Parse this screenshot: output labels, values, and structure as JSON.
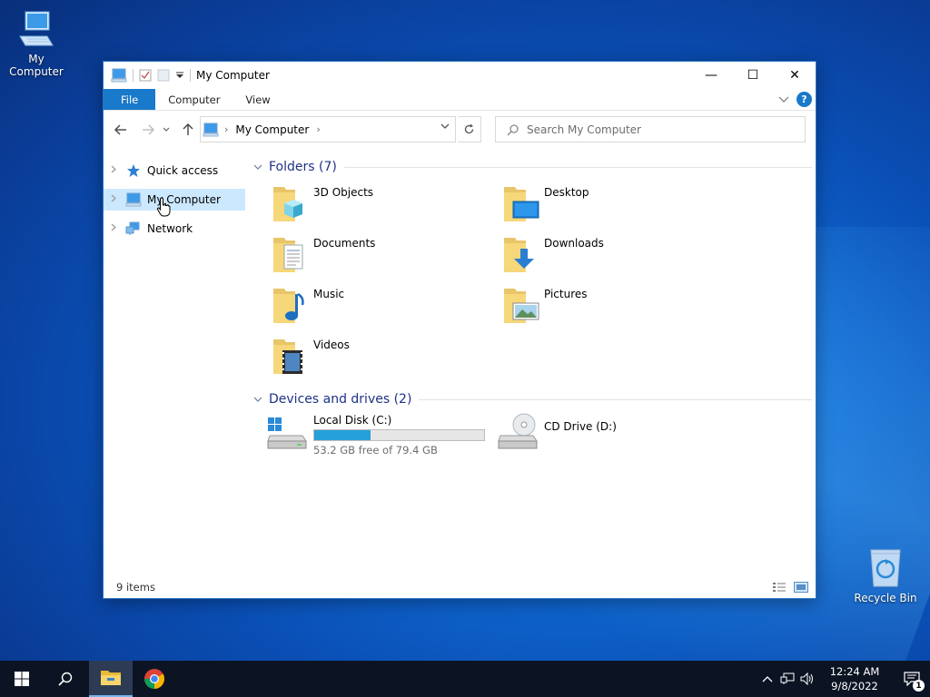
{
  "desktop": {
    "icons": [
      {
        "label": "My Computer",
        "icon": "computer-icon"
      },
      {
        "label": "Recycle Bin",
        "icon": "recycle-bin-icon"
      }
    ]
  },
  "window": {
    "title": "My Computer",
    "controls": {
      "minimize": "—",
      "maximize": "☐",
      "close": "✕"
    },
    "ribbon_tabs": [
      "File",
      "Computer",
      "View"
    ],
    "help": "?",
    "address": {
      "crumb": "My Computer",
      "chevron": "›"
    },
    "search": {
      "placeholder": "Search My Computer"
    },
    "nav": [
      {
        "label": "Quick access",
        "icon": "star-icon",
        "selected": false
      },
      {
        "label": "My Computer",
        "icon": "computer-icon",
        "selected": true
      },
      {
        "label": "Network",
        "icon": "network-icon",
        "selected": false
      }
    ],
    "folders_header": "Folders (7)",
    "folders": [
      {
        "label": "3D Objects",
        "icon": "3d-objects-icon"
      },
      {
        "label": "Desktop",
        "icon": "desktop-folder-icon"
      },
      {
        "label": "Documents",
        "icon": "documents-folder-icon"
      },
      {
        "label": "Downloads",
        "icon": "downloads-folder-icon"
      },
      {
        "label": "Music",
        "icon": "music-folder-icon"
      },
      {
        "label": "Pictures",
        "icon": "pictures-folder-icon"
      },
      {
        "label": "Videos",
        "icon": "videos-folder-icon"
      }
    ],
    "drives_header": "Devices and drives (2)",
    "drives": [
      {
        "label": "Local Disk (C:)",
        "free_text": "53.2 GB free of 79.4 GB",
        "used_fraction": 0.33,
        "icon": "windows-drive-icon"
      },
      {
        "label": "CD Drive (D:)",
        "icon": "cd-drive-icon"
      }
    ],
    "status": "9 items"
  },
  "taskbar": {
    "clock_time": "12:24 AM",
    "clock_date": "9/8/2022",
    "notification_count": "1",
    "colors": {
      "bar": "#0c1424",
      "accent": "#1979ca"
    }
  }
}
